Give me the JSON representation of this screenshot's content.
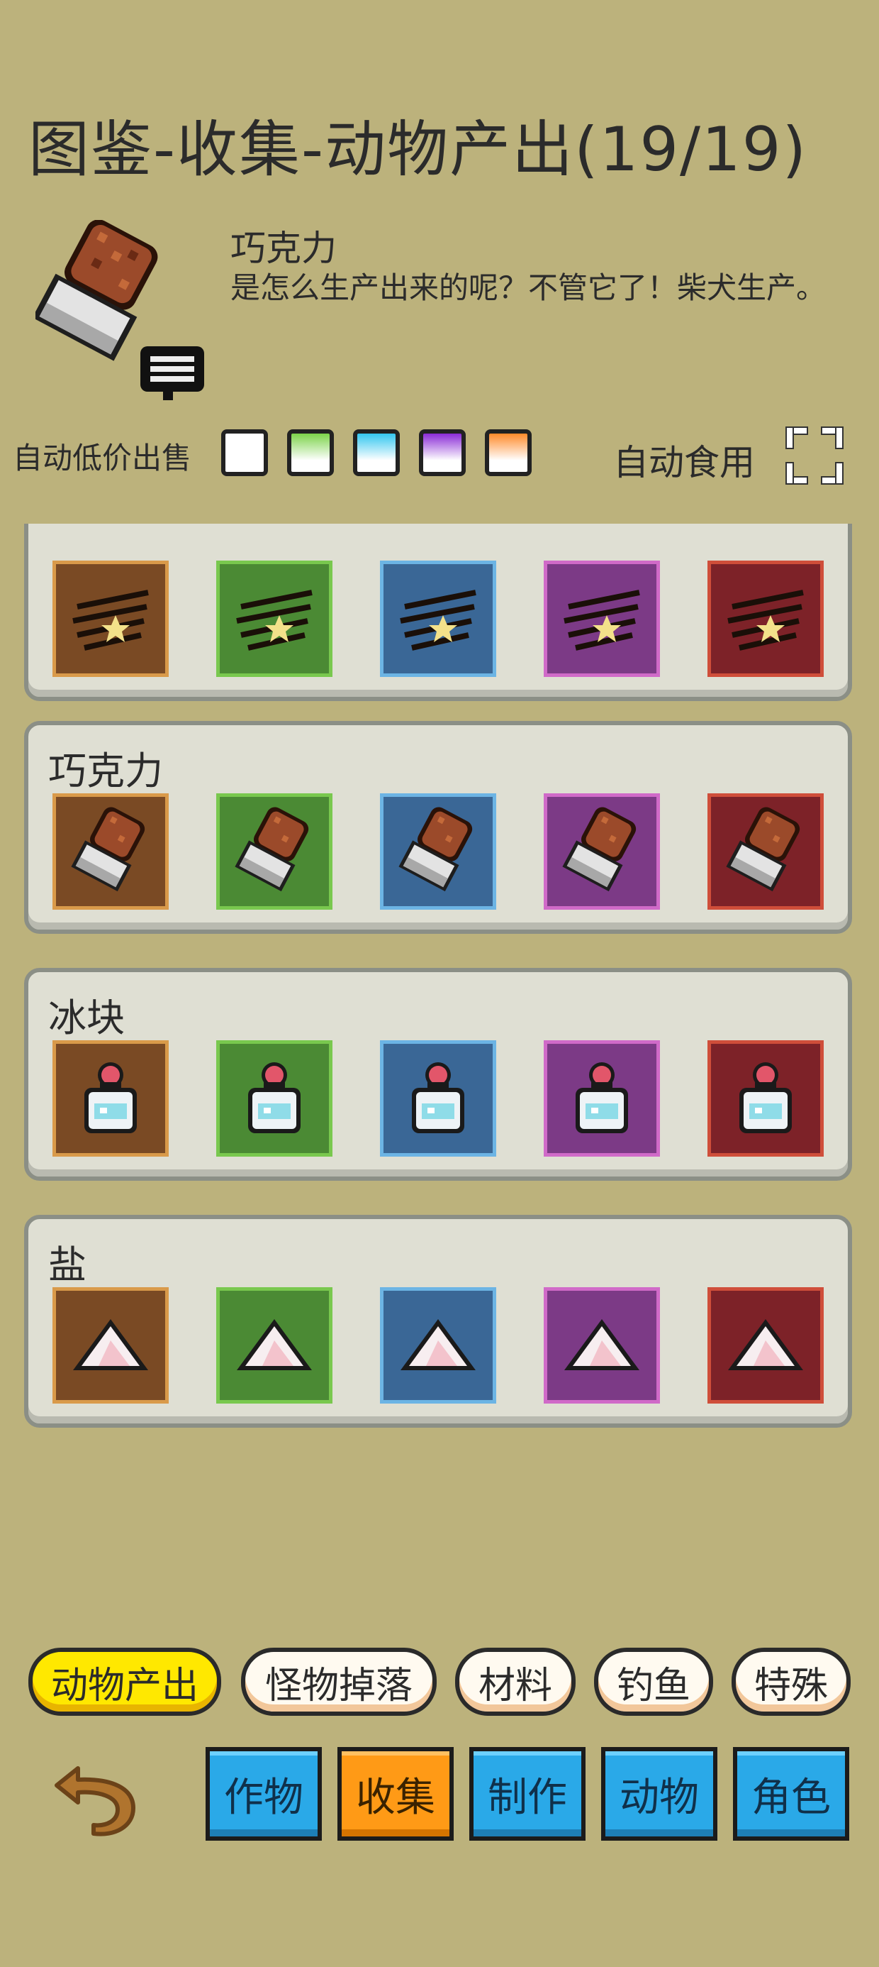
{
  "title": "图鉴-收集-动物产出(19/19)",
  "detail": {
    "name": "巧克力",
    "description": "是怎么生产出来的呢？不管它了！柴犬生产。",
    "icon": "chocolate-icon"
  },
  "auto_sell": {
    "label": "自动低价出售",
    "swatches": [
      {
        "name": "white",
        "color": "#ffffff"
      },
      {
        "name": "green",
        "color": "#7cd34a"
      },
      {
        "name": "blue",
        "color": "#33c6ef"
      },
      {
        "name": "purple",
        "color": "#8a2bd6"
      },
      {
        "name": "orange",
        "color": "#ff8a2a"
      }
    ]
  },
  "auto_eat": {
    "label": "自动食用",
    "icon": "expand-corners-icon"
  },
  "rarity_colors": [
    "#7a4a24",
    "#4b8a34",
    "#3a6796",
    "#7c3a86",
    "#7d2228"
  ],
  "rarity_borders": [
    "#d99a4a",
    "#79c84e",
    "#6cb4e4",
    "#d06ac8",
    "#cf4e3a"
  ],
  "panels": [
    {
      "title": "",
      "item": "hair-icon"
    },
    {
      "title": "巧克力",
      "item": "chocolate-icon"
    },
    {
      "title": "冰块",
      "item": "ice-jar-icon"
    },
    {
      "title": "盐",
      "item": "salt-icon"
    }
  ],
  "category_tabs": [
    {
      "label": "动物产出",
      "active": true
    },
    {
      "label": "怪物掉落",
      "active": false
    },
    {
      "label": "材料",
      "active": false
    },
    {
      "label": "钓鱼",
      "active": false
    },
    {
      "label": "特殊",
      "active": false
    }
  ],
  "nav": [
    {
      "label": "作物",
      "active": false
    },
    {
      "label": "收集",
      "active": true
    },
    {
      "label": "制作",
      "active": false
    },
    {
      "label": "动物",
      "active": false
    },
    {
      "label": "角色",
      "active": false
    }
  ],
  "back_icon": "undo-arrow-icon"
}
